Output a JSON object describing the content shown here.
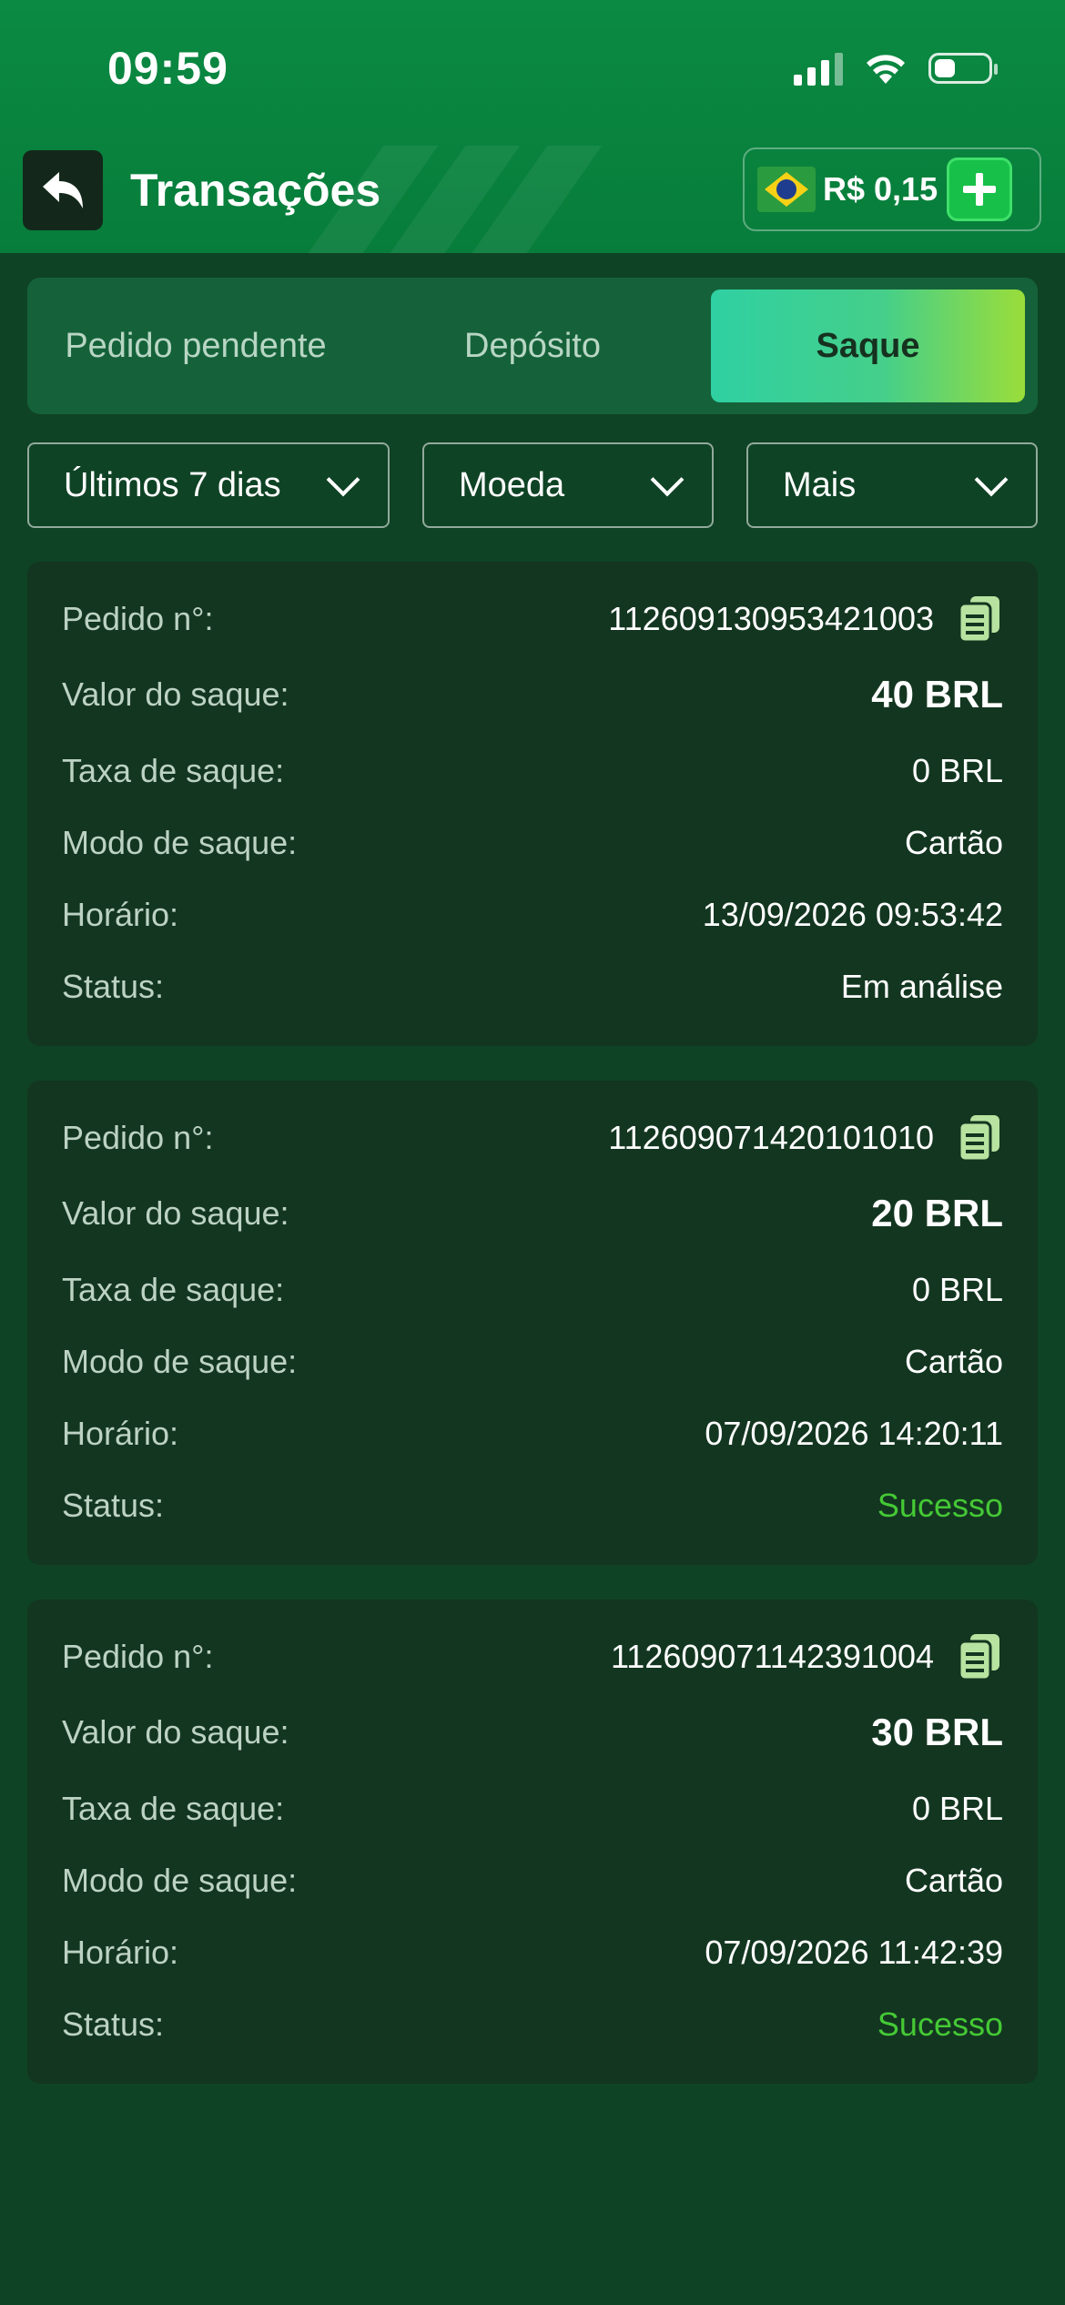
{
  "status_bar": {
    "time": "09:59"
  },
  "header": {
    "title": "Transações",
    "balance": "R$ 0,15"
  },
  "tabs": [
    {
      "label": "Pedido pendente",
      "active": false
    },
    {
      "label": "Depósito",
      "active": false
    },
    {
      "label": "Saque",
      "active": true
    }
  ],
  "filters": {
    "period": "Últimos 7 dias",
    "currency": "Moeda",
    "more": "Mais"
  },
  "labels": {
    "order": "Pedido n°:",
    "amount": "Valor do saque:",
    "fee": "Taxa de saque:",
    "mode": "Modo de saque:",
    "time": "Horário:",
    "status": "Status:"
  },
  "transactions": [
    {
      "order_no": "112609130953421003",
      "amount": "40 BRL",
      "fee": "0 BRL",
      "mode": "Cartão",
      "time": "13/09/2026 09:53:42",
      "status": "Em análise"
    },
    {
      "order_no": "112609071420101010",
      "amount": "20 BRL",
      "fee": "0 BRL",
      "mode": "Cartão",
      "time": "07/09/2026 14:20:11",
      "status": "Sucesso"
    },
    {
      "order_no": "112609071142391004",
      "amount": "30 BRL",
      "fee": "0 BRL",
      "mode": "Cartão",
      "time": "07/09/2026 11:42:39",
      "status": "Sucesso"
    }
  ],
  "colors": {
    "success": "#45c935",
    "accent": "#17c049",
    "background": "#0f4325"
  }
}
